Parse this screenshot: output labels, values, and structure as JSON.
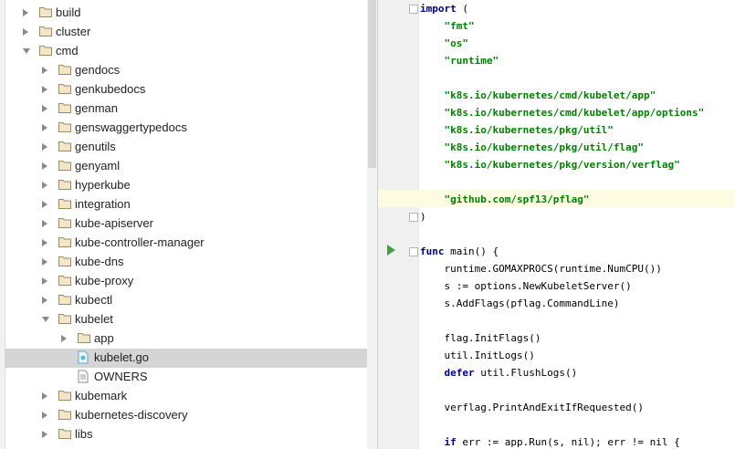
{
  "tree": {
    "items": [
      {
        "label": "build",
        "type": "folder",
        "depth": 1,
        "state": "collapsed",
        "selected": false
      },
      {
        "label": "cluster",
        "type": "folder",
        "depth": 1,
        "state": "collapsed",
        "selected": false
      },
      {
        "label": "cmd",
        "type": "folder",
        "depth": 1,
        "state": "expanded",
        "selected": false
      },
      {
        "label": "gendocs",
        "type": "folder",
        "depth": 2,
        "state": "collapsed",
        "selected": false
      },
      {
        "label": "genkubedocs",
        "type": "folder",
        "depth": 2,
        "state": "collapsed",
        "selected": false
      },
      {
        "label": "genman",
        "type": "folder",
        "depth": 2,
        "state": "collapsed",
        "selected": false
      },
      {
        "label": "genswaggertypedocs",
        "type": "folder",
        "depth": 2,
        "state": "collapsed",
        "selected": false
      },
      {
        "label": "genutils",
        "type": "folder",
        "depth": 2,
        "state": "collapsed",
        "selected": false
      },
      {
        "label": "genyaml",
        "type": "folder",
        "depth": 2,
        "state": "collapsed",
        "selected": false
      },
      {
        "label": "hyperkube",
        "type": "folder",
        "depth": 2,
        "state": "collapsed",
        "selected": false
      },
      {
        "label": "integration",
        "type": "folder",
        "depth": 2,
        "state": "collapsed",
        "selected": false
      },
      {
        "label": "kube-apiserver",
        "type": "folder",
        "depth": 2,
        "state": "collapsed",
        "selected": false
      },
      {
        "label": "kube-controller-manager",
        "type": "folder",
        "depth": 2,
        "state": "collapsed",
        "selected": false
      },
      {
        "label": "kube-dns",
        "type": "folder",
        "depth": 2,
        "state": "collapsed",
        "selected": false
      },
      {
        "label": "kube-proxy",
        "type": "folder",
        "depth": 2,
        "state": "collapsed",
        "selected": false
      },
      {
        "label": "kubectl",
        "type": "folder",
        "depth": 2,
        "state": "collapsed",
        "selected": false
      },
      {
        "label": "kubelet",
        "type": "folder",
        "depth": 2,
        "state": "expanded",
        "selected": false
      },
      {
        "label": "app",
        "type": "folder",
        "depth": 3,
        "state": "collapsed",
        "selected": false
      },
      {
        "label": "kubelet.go",
        "type": "go-file",
        "depth": 3,
        "state": "none",
        "selected": true
      },
      {
        "label": "OWNERS",
        "type": "text-file",
        "depth": 3,
        "state": "none",
        "selected": false
      },
      {
        "label": "kubemark",
        "type": "folder",
        "depth": 2,
        "state": "collapsed",
        "selected": false
      },
      {
        "label": "kubernetes-discovery",
        "type": "folder",
        "depth": 2,
        "state": "collapsed",
        "selected": false
      },
      {
        "label": "libs",
        "type": "folder",
        "depth": 2,
        "state": "collapsed",
        "selected": false
      }
    ]
  },
  "editor": {
    "lines": [
      {
        "segments": [
          {
            "t": "import",
            "c": "kw"
          },
          {
            "t": " (",
            "c": ""
          }
        ]
      },
      {
        "segments": [
          {
            "t": "    ",
            "c": ""
          },
          {
            "t": "\"fmt\"",
            "c": "str"
          }
        ]
      },
      {
        "segments": [
          {
            "t": "    ",
            "c": ""
          },
          {
            "t": "\"os\"",
            "c": "str"
          }
        ]
      },
      {
        "segments": [
          {
            "t": "    ",
            "c": ""
          },
          {
            "t": "\"runtime\"",
            "c": "str"
          }
        ]
      },
      {
        "segments": []
      },
      {
        "segments": [
          {
            "t": "    ",
            "c": ""
          },
          {
            "t": "\"k8s.io/kubernetes/cmd/kubelet/app\"",
            "c": "str"
          }
        ]
      },
      {
        "segments": [
          {
            "t": "    ",
            "c": ""
          },
          {
            "t": "\"k8s.io/kubernetes/cmd/kubelet/app/options\"",
            "c": "str"
          }
        ]
      },
      {
        "segments": [
          {
            "t": "    ",
            "c": ""
          },
          {
            "t": "\"k8s.io/kubernetes/pkg/util\"",
            "c": "str"
          }
        ]
      },
      {
        "segments": [
          {
            "t": "    ",
            "c": ""
          },
          {
            "t": "\"k8s.io/kubernetes/pkg/util/flag\"",
            "c": "str"
          }
        ]
      },
      {
        "segments": [
          {
            "t": "    ",
            "c": ""
          },
          {
            "t": "\"k8s.io/kubernetes/pkg/version/verflag\"",
            "c": "str"
          }
        ]
      },
      {
        "segments": []
      },
      {
        "segments": [
          {
            "t": "    ",
            "c": ""
          },
          {
            "t": "\"github.com/spf13/pflag\"",
            "c": "str"
          }
        ]
      },
      {
        "segments": [
          {
            "t": ")",
            "c": ""
          }
        ]
      },
      {
        "segments": []
      },
      {
        "segments": [
          {
            "t": "func",
            "c": "kw"
          },
          {
            "t": " main() {",
            "c": ""
          }
        ]
      },
      {
        "segments": [
          {
            "t": "    runtime.GOMAXPROCS(runtime.NumCPU())",
            "c": ""
          }
        ]
      },
      {
        "segments": [
          {
            "t": "    s := options.NewKubeletServer()",
            "c": ""
          }
        ]
      },
      {
        "segments": [
          {
            "t": "    s.AddFlags(pflag.CommandLine)",
            "c": ""
          }
        ]
      },
      {
        "segments": []
      },
      {
        "segments": [
          {
            "t": "    flag.InitFlags()",
            "c": ""
          }
        ]
      },
      {
        "segments": [
          {
            "t": "    util.InitLogs()",
            "c": ""
          }
        ]
      },
      {
        "segments": [
          {
            "t": "    ",
            "c": ""
          },
          {
            "t": "defer",
            "c": "kw"
          },
          {
            "t": " util.FlushLogs()",
            "c": ""
          }
        ]
      },
      {
        "segments": []
      },
      {
        "segments": [
          {
            "t": "    verflag.PrintAndExitIfRequested()",
            "c": ""
          }
        ]
      },
      {
        "segments": []
      },
      {
        "segments": [
          {
            "t": "    ",
            "c": ""
          },
          {
            "t": "if",
            "c": "kw"
          },
          {
            "t": " err := app.Run(s, nil); err != nil {",
            "c": ""
          }
        ]
      }
    ]
  }
}
